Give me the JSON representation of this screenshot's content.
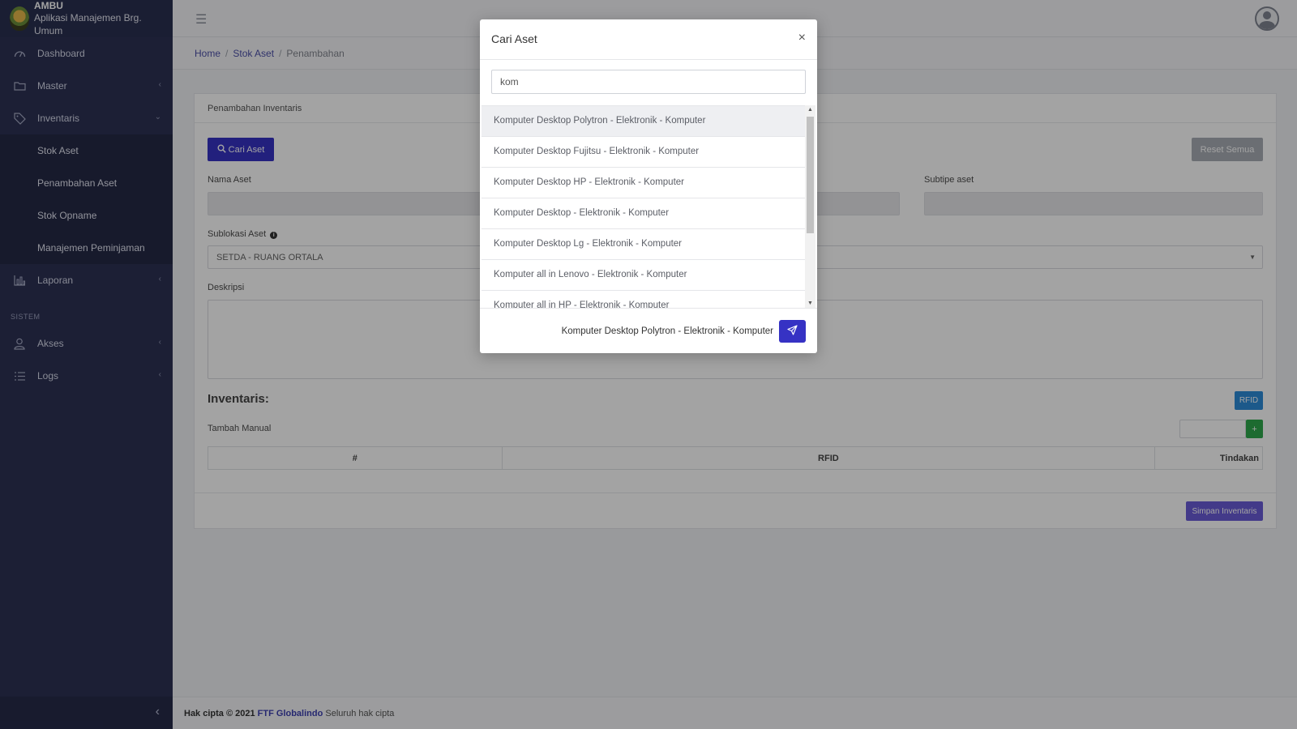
{
  "brand": {
    "name": "AMBU",
    "subtitle": "Aplikasi Manajemen Brg. Umum"
  },
  "sidebar": {
    "items": [
      {
        "label": "Dashboard"
      },
      {
        "label": "Master"
      },
      {
        "label": "Inventaris"
      }
    ],
    "sub_items": [
      {
        "label": "Stok Aset"
      },
      {
        "label": "Penambahan Aset"
      },
      {
        "label": "Stok Opname"
      },
      {
        "label": "Manajemen Peminjaman"
      }
    ],
    "report": {
      "label": "Laporan"
    },
    "section": "SISTEM",
    "system_items": [
      {
        "label": "Akses"
      },
      {
        "label": "Logs"
      }
    ]
  },
  "breadcrumb": {
    "home": "Home",
    "stock": "Stok Aset",
    "current": "Penambahan"
  },
  "card": {
    "title": "Penambahan Inventaris",
    "search_button": "Cari Aset",
    "reset_button": "Reset Semua",
    "asset_name_label": "Nama Aset",
    "subtype_label": "Subtipe aset",
    "sublocation_label": "Sublokasi Aset",
    "sublocation_value": "SETDA - RUANG ORTALA",
    "description_label": "Deskripsi",
    "inventory_title": "Inventaris:",
    "rfid_button": "RFID",
    "manual_label": "Tambah Manual",
    "add_button": "+",
    "table_headers": [
      "#",
      "RFID",
      "Tindakan"
    ],
    "save_button": "Simpan Inventaris"
  },
  "footer": {
    "prefix": "Hak cipta © 2021",
    "company": "FTF Globalindo",
    "suffix": "Seluruh hak cipta"
  },
  "modal": {
    "title": "Cari Aset",
    "close": "×",
    "search_value": "kom",
    "results": [
      "Komputer Desktop Polytron - Elektronik - Komputer",
      "Komputer Desktop Fujitsu - Elektronik - Komputer",
      "Komputer Desktop HP - Elektronik - Komputer",
      "Komputer Desktop - Elektronik - Komputer",
      "Komputer Desktop Lg - Elektronik - Komputer",
      "Komputer all in Lenovo - Elektronik - Komputer",
      "Komputer all in HP - Elektronik - Komputer"
    ],
    "selected": "Komputer Desktop Polytron - Elektronik - Komputer"
  },
  "colors": {
    "primary": "#3632c4",
    "sidebar": "#2c3153",
    "success": "#2ea84b",
    "info": "#2d8bd8"
  }
}
